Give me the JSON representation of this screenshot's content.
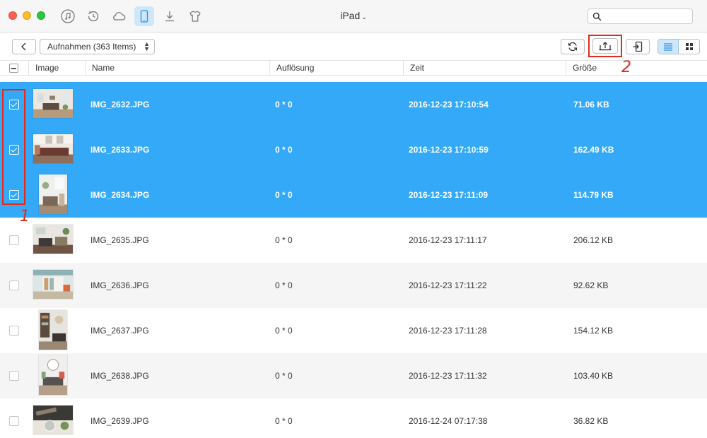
{
  "window": {
    "device_title": "iPad",
    "nav_icons": [
      "music-icon",
      "history-icon",
      "cloud-icon",
      "ipad-icon",
      "download-icon",
      "shirt-icon"
    ],
    "active_nav": "ipad-icon",
    "search_placeholder": ""
  },
  "toolbar": {
    "folder_label": "Aufnahmen (363 Items)",
    "buttons": [
      "back-icon",
      "refresh-icon",
      "export-to-computer-icon",
      "import-to-device-icon",
      "list-view-icon",
      "grid-view-icon"
    ],
    "active_view": "list"
  },
  "annotations": {
    "step1": "1",
    "step2": "2",
    "highlight_color": "#e2291c"
  },
  "table": {
    "columns": {
      "image": "Image",
      "name": "Name",
      "resolution": "Auflösung",
      "time": "Zeit",
      "size": "Größe"
    },
    "rows": [
      {
        "name": "IMG_2632.JPG",
        "resolution": "0 * 0",
        "time": "2016-12-23 17:10:54",
        "size": "71.06 KB",
        "selected": true
      },
      {
        "name": "IMG_2633.JPG",
        "resolution": "0 * 0",
        "time": "2016-12-23 17:10:59",
        "size": "162.49 KB",
        "selected": true
      },
      {
        "name": "IMG_2634.JPG",
        "resolution": "0 * 0",
        "time": "2016-12-23 17:11:09",
        "size": "114.79 KB",
        "selected": true
      },
      {
        "name": "IMG_2635.JPG",
        "resolution": "0 * 0",
        "time": "2016-12-23 17:11:17",
        "size": "206.12 KB",
        "selected": false
      },
      {
        "name": "IMG_2636.JPG",
        "resolution": "0 * 0",
        "time": "2016-12-23 17:11:22",
        "size": "92.62 KB",
        "selected": false
      },
      {
        "name": "IMG_2637.JPG",
        "resolution": "0 * 0",
        "time": "2016-12-23 17:11:28",
        "size": "154.12 KB",
        "selected": false
      },
      {
        "name": "IMG_2638.JPG",
        "resolution": "0 * 0",
        "time": "2016-12-23 17:11:32",
        "size": "103.40 KB",
        "selected": false
      },
      {
        "name": "IMG_2639.JPG",
        "resolution": "0 * 0",
        "time": "2016-12-24 07:17:38",
        "size": "36.82 KB",
        "selected": false
      }
    ]
  },
  "colors": {
    "selection": "#33a9f8",
    "active_tab": "#cfe7fb"
  }
}
